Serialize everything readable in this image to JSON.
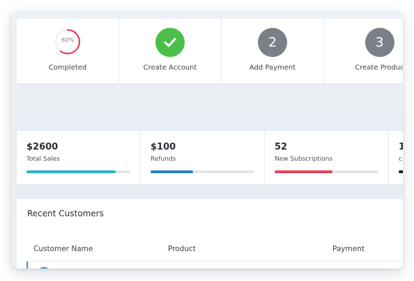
{
  "steps": [
    {
      "label": "Completed",
      "type": "progress",
      "percent_text": "60%",
      "percent": 0.6
    },
    {
      "label": "Create Account",
      "type": "done",
      "icon": "check-icon"
    },
    {
      "label": "Add Payment",
      "type": "pending",
      "number": "2"
    },
    {
      "label": "Create Produc",
      "type": "pending",
      "number": "3"
    }
  ],
  "stats": [
    {
      "value": "$2600",
      "caption": "Total Sales",
      "progress": 0.86,
      "color": "#2bb3c8"
    },
    {
      "value": "$100",
      "caption": "Refunds",
      "progress": 0.41,
      "color": "#2a7fc5"
    },
    {
      "value": "52",
      "caption": "New Subscriptions",
      "progress": 0.56,
      "color": "#e8425a"
    }
  ],
  "stat_partial": {
    "value": "1",
    "caption": "c",
    "progress": 1,
    "color": "#1d1f22"
  },
  "customers": {
    "title": "Recent Customers",
    "columns": [
      "Customer Name",
      "Product",
      "Payment"
    ]
  },
  "colors": {
    "success": "#4cbf4a",
    "pending": "#7b8088",
    "progress_ring": "#e8425a"
  }
}
